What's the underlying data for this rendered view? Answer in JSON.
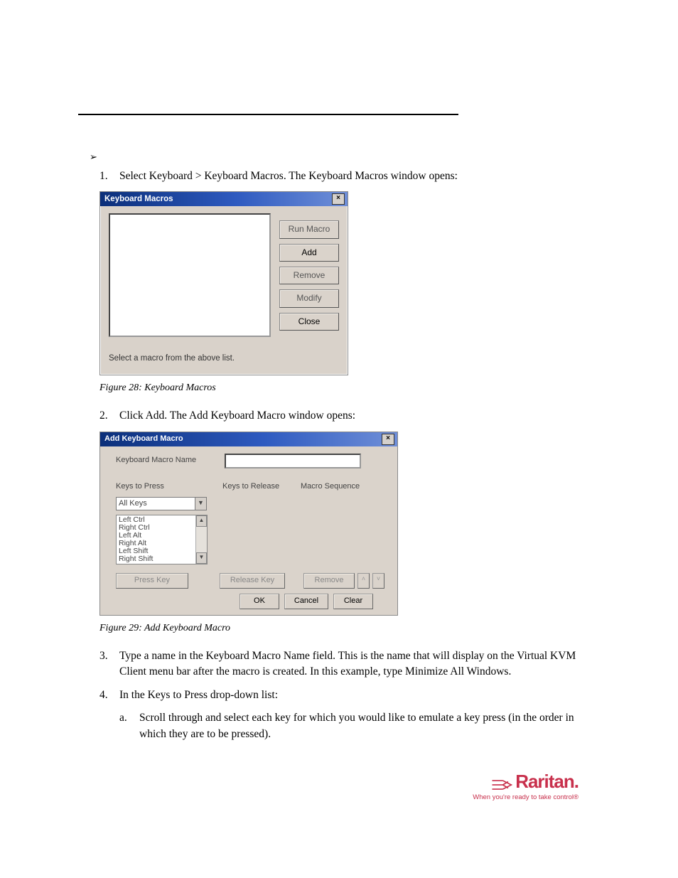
{
  "steps": {
    "s1": "Select Keyboard > Keyboard Macros. The Keyboard Macros window opens:",
    "s2": "Click Add. The Add Keyboard Macro window opens:",
    "s3": "Type a name in the Keyboard Macro Name field. This is the name that will display on the Virtual KVM Client menu bar after the macro is created. In this example, type Minimize All Windows.",
    "s4": "In the Keys to Press drop-down list:",
    "s4a": "Scroll through and select each key for which you would like to emulate a key press (in the order in which they are to be pressed)."
  },
  "captions": {
    "fig28": "Figure 28: Keyboard Macros",
    "fig29": "Figure 29: Add Keyboard Macro"
  },
  "dialog1": {
    "title": "Keyboard Macros",
    "buttons": {
      "run": "Run Macro",
      "add": "Add",
      "remove": "Remove",
      "modify": "Modify",
      "close": "Close"
    },
    "status": "Select a macro from the above list."
  },
  "dialog2": {
    "title": "Add Keyboard Macro",
    "labels": {
      "name": "Keyboard Macro Name",
      "press": "Keys to Press",
      "release": "Keys to Release",
      "sequence": "Macro Sequence"
    },
    "combo": "All Keys",
    "keys": [
      "Left Ctrl",
      "Right Ctrl",
      "Left Alt",
      "Right Alt",
      "Left Shift",
      "Right Shift"
    ],
    "buttons": {
      "pressKey": "Press Key",
      "releaseKey": "Release Key",
      "remove": "Remove",
      "ok": "OK",
      "cancel": "Cancel",
      "clear": "Clear"
    }
  },
  "footer": {
    "brand": "Raritan.",
    "tagline": "When you're ready to take control®"
  }
}
